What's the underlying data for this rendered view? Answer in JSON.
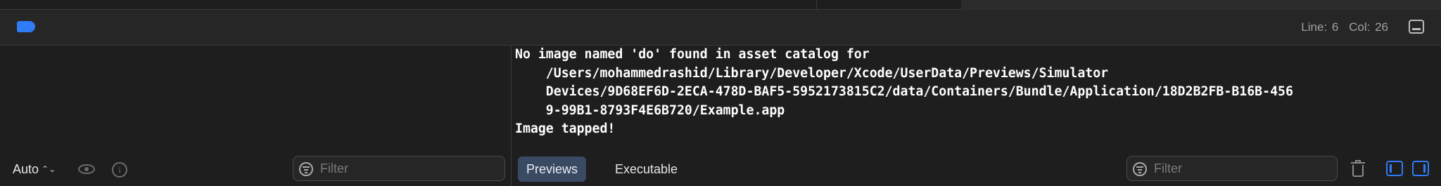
{
  "debug_bar": {
    "line_label": "Line:",
    "line_value": "6",
    "col_label": "Col:",
    "col_value": "26",
    "accent_color": "#2f7cf6"
  },
  "variables_pane": {
    "scope_select": "Auto",
    "scope_chevron": "⌃⌄",
    "filter_placeholder": "Filter",
    "icons": [
      "eye-icon",
      "info-icon",
      "filter-icon"
    ]
  },
  "console": {
    "lines": [
      "No image named 'do' found in asset catalog for",
      "    /Users/mohammedrashid/Library/Developer/Xcode/UserData/Previews/Simulator",
      "    Devices/9D68EF6D-2ECA-478D-BAF5-5952173815C2/data/Containers/Bundle/Application/18D2B2FB-B16B-456",
      "    9-99B1-8793F4E6B720/Example.app",
      "Image tapped!"
    ]
  },
  "console_bar": {
    "tabs": [
      {
        "label": "Previews",
        "selected": true
      },
      {
        "label": "Executable",
        "selected": false
      }
    ],
    "filter_placeholder": "Filter",
    "icons": [
      "filter-icon",
      "trash-icon",
      "show-left-pane-icon",
      "show-right-pane-icon"
    ]
  }
}
